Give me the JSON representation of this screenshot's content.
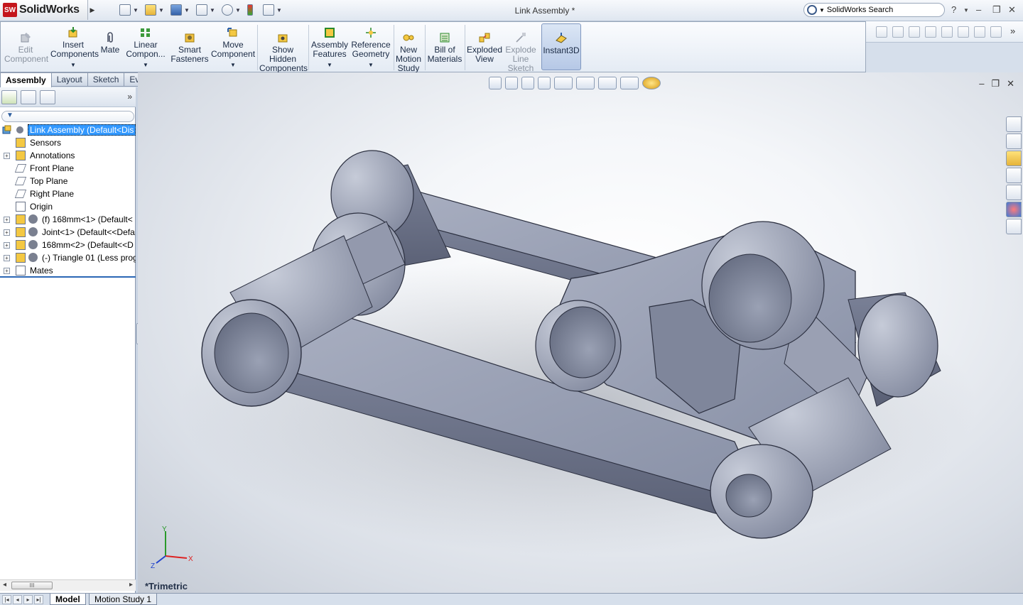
{
  "titlebar": {
    "app_name": "SolidWorks",
    "document_title": "Link Assembly *",
    "search_placeholder": "SolidWorks Search",
    "help": "?"
  },
  "commands": [
    {
      "label": "Edit Component",
      "disabled": true
    },
    {
      "label": "Insert Components",
      "dropdown": true
    },
    {
      "label": "Mate"
    },
    {
      "label": "Linear Compon...",
      "dropdown": true
    },
    {
      "label": "Smart Fasteners"
    },
    {
      "label": "Move Component",
      "dropdown": true
    },
    {
      "label": "Show Hidden Components"
    },
    {
      "label": "Assembly Features",
      "dropdown": true
    },
    {
      "label": "Reference Geometry",
      "dropdown": true
    },
    {
      "label": "New Motion Study"
    },
    {
      "label": "Bill of Materials"
    },
    {
      "label": "Exploded View"
    },
    {
      "label": "Explode Line Sketch",
      "disabled": true
    },
    {
      "label": "Instant3D",
      "active": true
    }
  ],
  "command_tabs": [
    {
      "label": "Assembly",
      "active": true
    },
    {
      "label": "Layout"
    },
    {
      "label": "Sketch"
    },
    {
      "label": "Evaluate"
    }
  ],
  "tree": {
    "root": "Link Assembly  (Default<Dis",
    "items": [
      {
        "label": "Sensors",
        "icon": "sensor-icon"
      },
      {
        "label": "Annotations",
        "icon": "annotations-icon",
        "expand": true
      },
      {
        "label": "Front Plane",
        "icon": "plane-icon"
      },
      {
        "label": "Top Plane",
        "icon": "plane-icon"
      },
      {
        "label": "Right Plane",
        "icon": "plane-icon"
      },
      {
        "label": "Origin",
        "icon": "origin-icon"
      },
      {
        "label": "(f) 168mm<1> (Default<",
        "icon": "part-icon",
        "expand": true,
        "sub": true
      },
      {
        "label": "Joint<1> (Default<<Defa",
        "icon": "part-icon",
        "expand": true,
        "sub": true
      },
      {
        "label": "168mm<2> (Default<<D",
        "icon": "part-icon",
        "expand": true,
        "sub": true
      },
      {
        "label": "(-) Triangle 01 (Less prog",
        "icon": "part-icon",
        "expand": true,
        "sub": true
      },
      {
        "label": "Mates",
        "icon": "mates-icon",
        "expand": true
      }
    ]
  },
  "viewport": {
    "view_name": "*Trimetric",
    "axis_x": "X",
    "axis_y": "Y",
    "axis_z": "Z"
  },
  "bottom_tabs": [
    {
      "label": "Model",
      "active": true
    },
    {
      "label": "Motion Study 1"
    }
  ],
  "colors": {
    "part_fill": "#8890a8",
    "part_light": "#b4bacb",
    "part_dark": "#5c6378",
    "selection": "#3399ff"
  }
}
